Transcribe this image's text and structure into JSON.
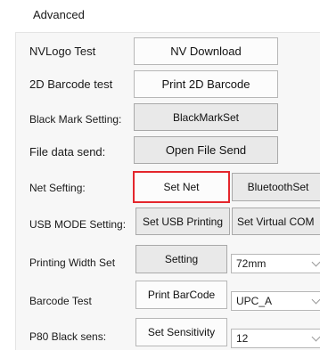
{
  "tab": {
    "title": "Advanced"
  },
  "rows": {
    "nvlogo": {
      "label": "NVLogo Test",
      "button": "NV Download"
    },
    "barcode2d": {
      "label": "2D Barcode test",
      "button": "Print 2D Barcode"
    },
    "blackmark": {
      "label": "Black Mark Setting:",
      "button": "BlackMarkSet"
    },
    "filesend": {
      "label": "File data send:",
      "button": "Open File Send"
    },
    "net": {
      "label": "Net Sefting:",
      "button": "Set Net",
      "button2": "BluetoothSet"
    },
    "usb": {
      "label": "USB MODE Setting:",
      "button": "Set USB Printing",
      "button2": "Set Virtual COM"
    },
    "width": {
      "label": "Printing Width Set",
      "button": "Setting",
      "select": "72mm"
    },
    "barcodetest": {
      "label": "Barcode Test",
      "button": "Print BarCode",
      "select": "UPC_A"
    },
    "p80": {
      "label": "P80 Black sens:",
      "button": "Set Sensitivity",
      "select": "12"
    }
  },
  "colors": {
    "highlight": "#e4262c",
    "panel": "#f7f7f7"
  }
}
